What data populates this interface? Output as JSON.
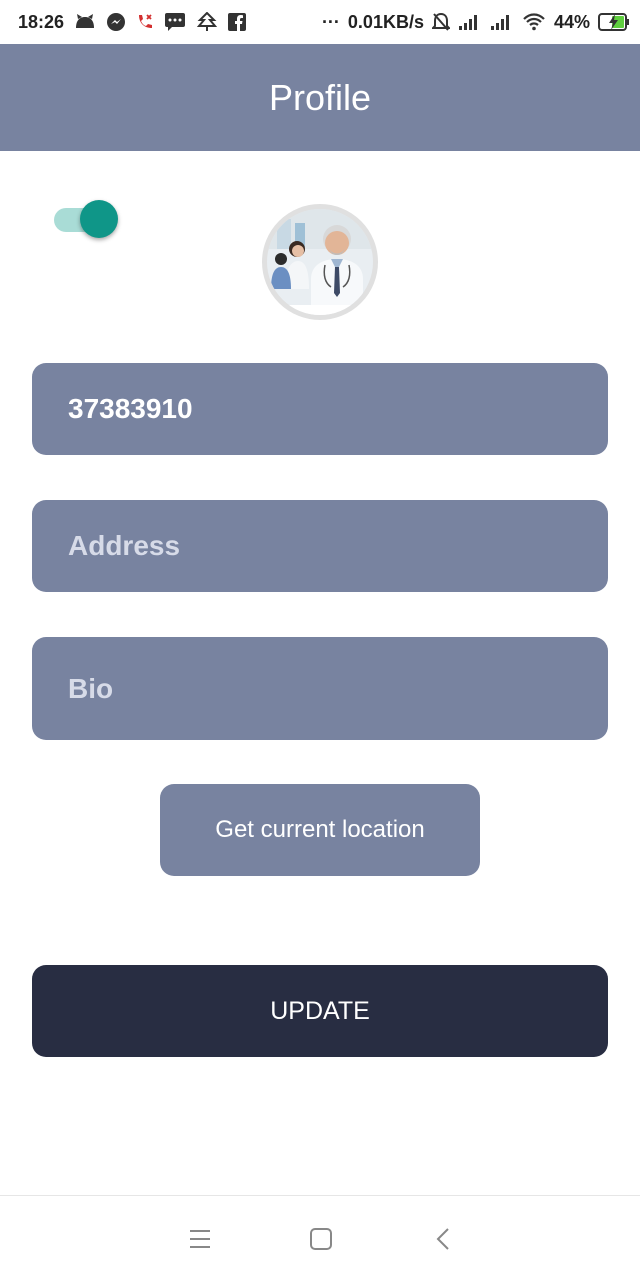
{
  "status_bar": {
    "time": "18:26",
    "network_speed": "0.01KB/s",
    "battery": "44%",
    "more_dots": "···",
    "icons": [
      "cat-app-icon",
      "messenger-icon",
      "missed-call-icon",
      "sms-icon",
      "tree-icon",
      "facebook-icon",
      "alarm-off-icon",
      "signal-icon",
      "signal-icon-2",
      "wifi-icon",
      "battery-charging-icon"
    ]
  },
  "app_bar": {
    "title": "Profile"
  },
  "toggle": {
    "state": "on",
    "accent": "#0f9688"
  },
  "avatar": {
    "alt": "doctor-avatar"
  },
  "form": {
    "phone_value": "37383910",
    "address_placeholder": "Address",
    "bio_placeholder": "Bio"
  },
  "buttons": {
    "location_label": "Get current location",
    "update_label": "UPDATE"
  },
  "colors": {
    "primary": "#7883a0",
    "dark": "#282d42",
    "accent": "#0f9688"
  },
  "nav_bar": {
    "items": [
      "menu-icon",
      "home-icon",
      "back-icon"
    ]
  }
}
